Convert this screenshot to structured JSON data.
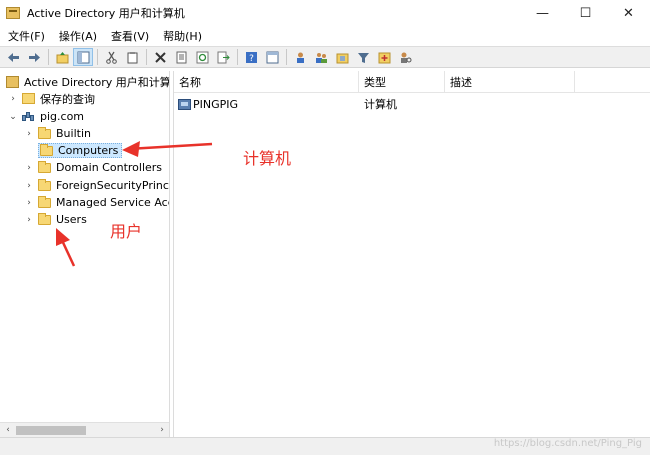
{
  "window": {
    "title": "Active Directory 用户和计算机",
    "minimize": "—",
    "maximize": "☐",
    "close": "✕"
  },
  "menu": [
    "文件(F)",
    "操作(A)",
    "查看(V)",
    "帮助(H)"
  ],
  "toolbar": {
    "icons": [
      "back-arrow-icon",
      "forward-arrow-icon",
      "up-folder-icon",
      "console-tree-icon",
      "cut-icon",
      "copy-icon",
      "delete-icon",
      "properties-icon",
      "refresh-icon",
      "export-list-icon",
      "help-icon",
      "show-pane-icon",
      "add-user-icon",
      "add-group-icon",
      "add-ou-icon",
      "filter-icon",
      "add-object-icon",
      "delegate-icon"
    ]
  },
  "tree": {
    "root": "Active Directory 用户和计算机",
    "saved_queries": "保存的查询",
    "domain": "pig.com",
    "containers": [
      "Builtin",
      "Computers",
      "Domain Controllers",
      "ForeignSecurityPrincipa",
      "Managed Service Acco",
      "Users"
    ],
    "selected": "Computers"
  },
  "list": {
    "columns": [
      "名称",
      "类型",
      "描述"
    ],
    "rows": [
      {
        "name": "PINGPIG",
        "type": "计算机",
        "description": ""
      }
    ]
  },
  "annotations": {
    "computers_label": "计算机",
    "users_label": "用户",
    "color": "#e8322a"
  },
  "watermark": "https://blog.csdn.net/Ping_Pig"
}
